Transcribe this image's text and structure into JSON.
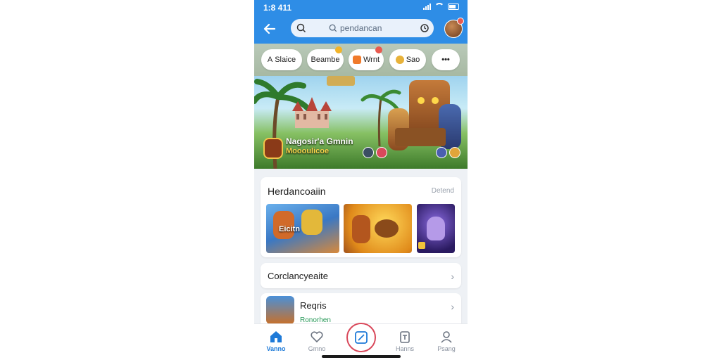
{
  "status_bar": {
    "time": "1:8 411"
  },
  "search": {
    "value": "pendancan"
  },
  "chips": [
    {
      "label": "Slaice",
      "icon": "outline-a-icon"
    },
    {
      "label": "Beambe",
      "icon": "badge-icon",
      "badge_color": "#f2b42a"
    },
    {
      "label": "Wrnt",
      "icon": "tile-icon",
      "badge_color": "#e85a4f"
    },
    {
      "label": "Sao",
      "icon": "leaf-icon"
    },
    {
      "label": "•••",
      "icon": "more-icon"
    }
  ],
  "banner": {
    "title": "Nagosir'a Gmnin",
    "subtitle": "Moooulicoe"
  },
  "section1": {
    "title": "Herdancoaiin",
    "link": "Detend",
    "tiles": [
      {
        "caption": "Eicitn"
      },
      {
        "caption": ""
      },
      {
        "caption": ""
      }
    ]
  },
  "row2": {
    "title": "Corclancyeaite"
  },
  "row3": {
    "title": "Reqris",
    "sub": "Ronorhen"
  },
  "nav": {
    "items": [
      {
        "label": "Vanno",
        "icon": "home-icon"
      },
      {
        "label": "Gmno",
        "icon": "heart-icon"
      },
      {
        "label": "",
        "icon": "edit-icon"
      },
      {
        "label": "Hanns",
        "icon": "clipboard-icon"
      },
      {
        "label": "Psang",
        "icon": "person-icon"
      }
    ]
  },
  "colors": {
    "accent": "#2e8de6",
    "active": "#1e7ad8",
    "center_ring": "#d9495b"
  }
}
